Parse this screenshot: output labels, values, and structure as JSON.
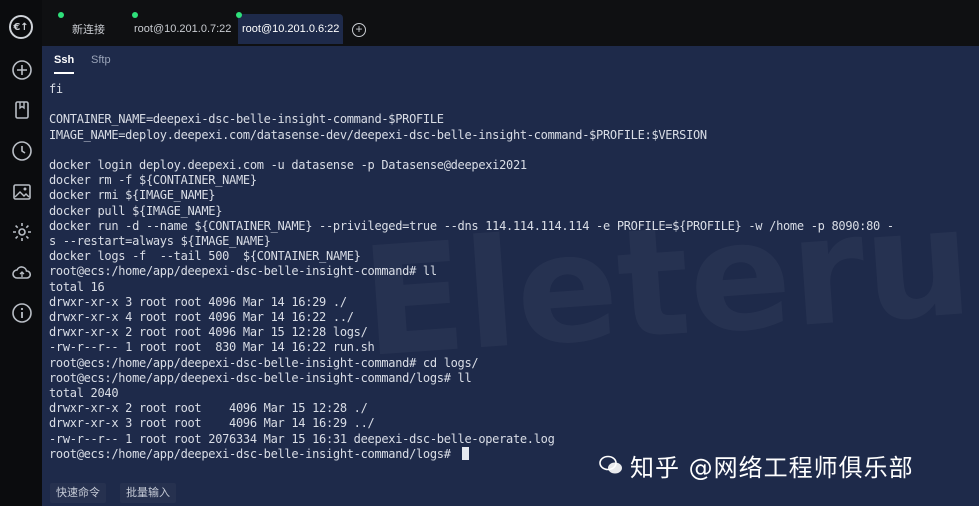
{
  "sidebar": {
    "logo": "€↑",
    "icons": [
      "plus-circle-icon",
      "bookmark-icon",
      "clock-icon",
      "image-icon",
      "gear-icon",
      "cloud-sync-icon",
      "info-icon"
    ]
  },
  "tabs": [
    {
      "label": "新连接",
      "active": false
    },
    {
      "label": "root@10.201.0.7:22",
      "active": false
    },
    {
      "label": "root@10.201.0.6:22",
      "active": true
    }
  ],
  "subtabs": {
    "ssh": "Ssh",
    "sftp": "Sftp"
  },
  "terminal_lines": [
    "fi",
    "",
    "CONTAINER_NAME=deepexi-dsc-belle-insight-command-$PROFILE",
    "IMAGE_NAME=deploy.deepexi.com/datasense-dev/deepexi-dsc-belle-insight-command-$PROFILE:$VERSION",
    "",
    "docker login deploy.deepexi.com -u datasense -p Datasense@deepexi2021",
    "docker rm -f ${CONTAINER_NAME}",
    "docker rmi ${IMAGE_NAME}",
    "docker pull ${IMAGE_NAME}",
    "docker run -d --name ${CONTAINER_NAME} --privileged=true --dns 114.114.114.114 -e PROFILE=${PROFILE} -w /home -p 8090:80 -",
    "s --restart=always ${IMAGE_NAME}",
    "docker logs -f  --tail 500  ${CONTAINER_NAME}",
    "root@ecs:/home/app/deepexi-dsc-belle-insight-command# ll",
    "total 16",
    "drwxr-xr-x 3 root root 4096 Mar 14 16:29 ./",
    "drwxr-xr-x 4 root root 4096 Mar 14 16:22 ../",
    "drwxr-xr-x 2 root root 4096 Mar 15 12:28 logs/",
    "-rw-r--r-- 1 root root  830 Mar 14 16:22 run.sh",
    "root@ecs:/home/app/deepexi-dsc-belle-insight-command# cd logs/",
    "root@ecs:/home/app/deepexi-dsc-belle-insight-command/logs# ll",
    "total 2040",
    "drwxr-xr-x 2 root root    4096 Mar 15 12:28 ./",
    "drwxr-xr-x 3 root root    4096 Mar 14 16:29 ../",
    "-rw-r--r-- 1 root root 2076334 Mar 15 16:31 deepexi-dsc-belle-operate.log",
    "root@ecs:/home/app/deepexi-dsc-belle-insight-command/logs# "
  ],
  "footer": {
    "quick_commands": "快速命令",
    "batch_input": "批量输入"
  },
  "watermark": {
    "background_text": "Eleteru",
    "brand_text": "知乎 @网络工程师俱乐部"
  },
  "colors": {
    "terminal_bg": "#1e2a4a",
    "app_bg": "#0f1012",
    "online_dot": "#2ee07a"
  }
}
